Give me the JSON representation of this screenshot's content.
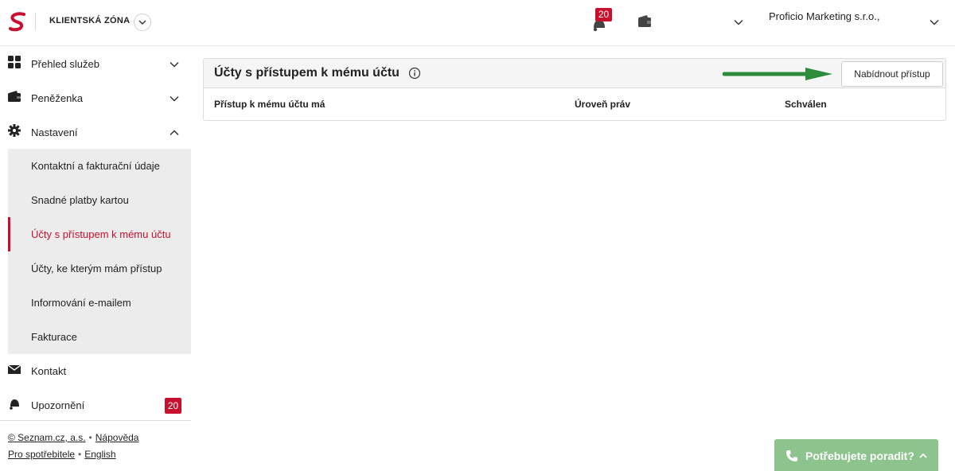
{
  "header": {
    "brand": "KLIENTSKÁ ZÓNA",
    "notifications_count": "20",
    "account_name": "Proficio Marketing s.r.o.,"
  },
  "sidebar": {
    "items": [
      {
        "label": "Přehled služeb"
      },
      {
        "label": "Peněženka"
      },
      {
        "label": "Nastavení"
      }
    ],
    "submenu": [
      {
        "label": "Kontaktní a fakturační údaje"
      },
      {
        "label": "Snadné platby kartou"
      },
      {
        "label": "Účty s přístupem k mému účtu"
      },
      {
        "label": "Účty, ke kterým mám přístup"
      },
      {
        "label": "Informování e-mailem"
      },
      {
        "label": "Fakturace"
      }
    ],
    "contact_label": "Kontakt",
    "alerts_label": "Upozornění",
    "alerts_count": "20"
  },
  "footer": {
    "seznam": "© Seznam.cz, a.s.",
    "help": "Nápověda",
    "consumers": "Pro spotřebitele",
    "english": "English"
  },
  "main": {
    "title": "Účty s přístupem k mému účtu",
    "offer_button": "Nabídnout přístup",
    "columns": [
      "Přístup k mému účtu má",
      "Úroveň práv",
      "Schválen"
    ]
  },
  "help_button": {
    "label": "Potřebujete poradit?"
  },
  "colors": {
    "accent": "#c8102e",
    "help_green": "#8dc38d",
    "arrow_green": "#2e8b3a"
  }
}
